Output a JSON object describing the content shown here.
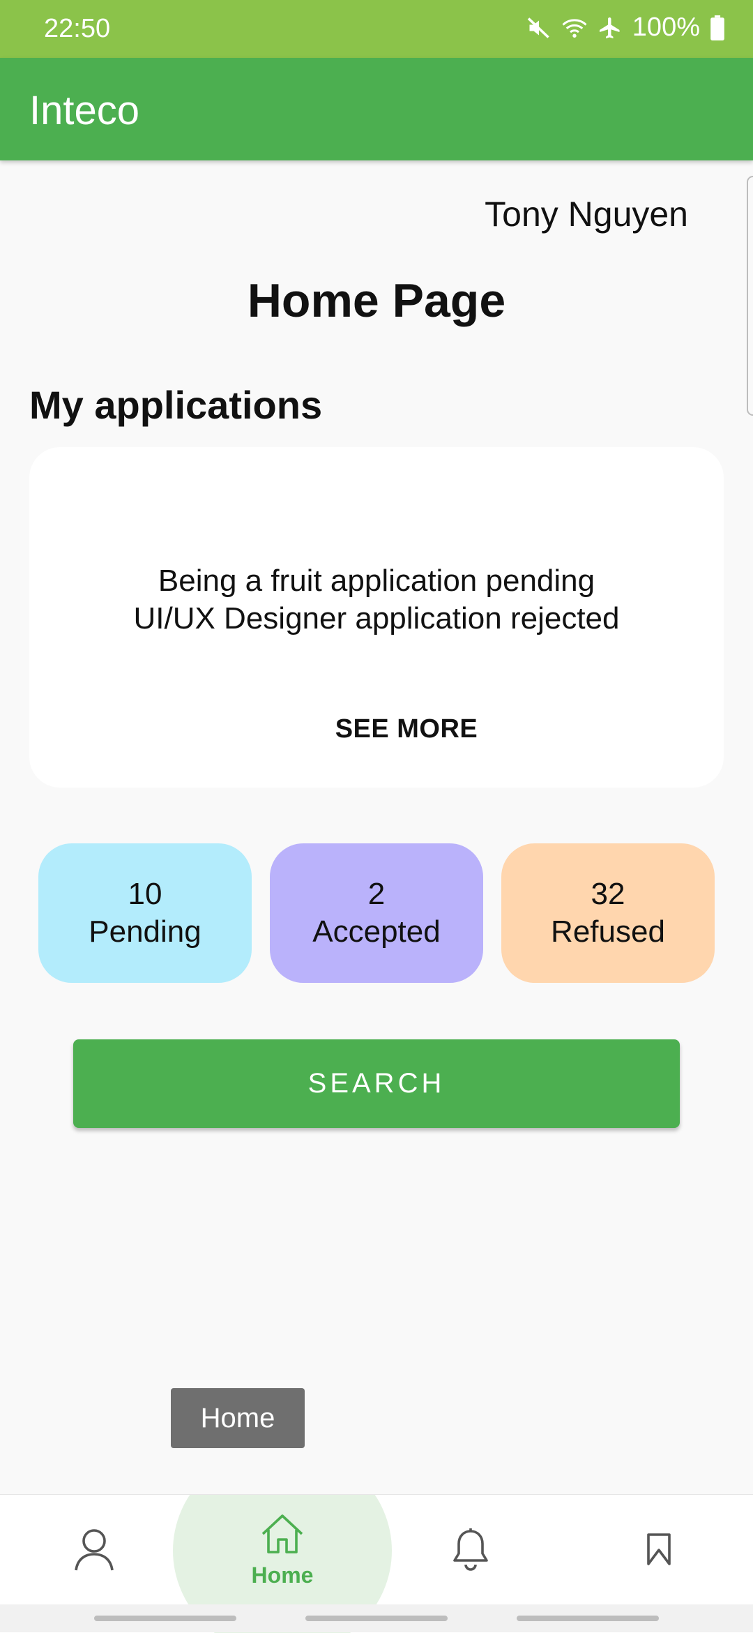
{
  "status_bar": {
    "time": "22:50",
    "battery": "100%",
    "icons": [
      "mute-icon",
      "wifi-icon",
      "airplane-icon",
      "battery-icon"
    ]
  },
  "app_bar": {
    "title": "Inteco"
  },
  "user": {
    "name": "Tony Nguyen"
  },
  "page": {
    "title": "Home Page"
  },
  "applications": {
    "section_title": "My applications",
    "items": [
      "Being a fruit application pending",
      "UI/UX Designer application rejected"
    ],
    "see_more_label": "SEE MORE"
  },
  "stats": [
    {
      "count": "10",
      "label": "Pending",
      "color": "#b3ecfc"
    },
    {
      "count": "2",
      "label": "Accepted",
      "color": "#bab2fb"
    },
    {
      "count": "32",
      "label": "Refused",
      "color": "#ffd6ae"
    }
  ],
  "search_button": {
    "label": "SEARCH"
  },
  "tooltip": {
    "text": "Home"
  },
  "bottom_nav": {
    "items": [
      {
        "icon": "profile-icon",
        "label": ""
      },
      {
        "icon": "home-icon",
        "label": "Home",
        "active": true
      },
      {
        "icon": "bell-icon",
        "label": ""
      },
      {
        "icon": "bookmark-icon",
        "label": ""
      }
    ]
  },
  "colors": {
    "status_bar": "#8bc34a",
    "app_bar": "#4caf50",
    "accent": "#4caf50"
  }
}
